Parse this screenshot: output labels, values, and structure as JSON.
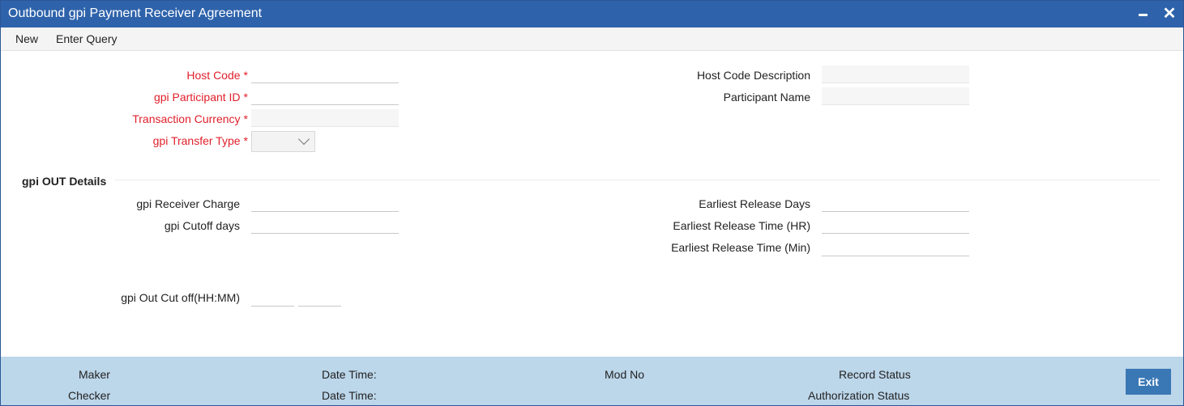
{
  "window": {
    "title": "Outbound gpi Payment Receiver Agreement",
    "close_glyph": "✕"
  },
  "menu": {
    "new": "New",
    "enter_query": "Enter Query"
  },
  "header_fields": {
    "host_code": {
      "label": "Host Code",
      "required_mark": "*",
      "value": ""
    },
    "gpi_participant_id": {
      "label": "gpi Participant ID",
      "required_mark": "*",
      "value": ""
    },
    "transaction_currency": {
      "label": "Transaction Currency",
      "required_mark": "*",
      "value": ""
    },
    "gpi_transfer_type": {
      "label": "gpi Transfer Type",
      "required_mark": "*",
      "value": ""
    },
    "host_code_description": {
      "label": "Host Code Description",
      "value": ""
    },
    "participant_name": {
      "label": "Participant Name",
      "value": ""
    }
  },
  "section": {
    "title": "gpi OUT Details"
  },
  "out_details": {
    "gpi_receiver_charge": {
      "label": "gpi Receiver Charge",
      "value": ""
    },
    "gpi_cutoff_days": {
      "label": "gpi Cutoff days",
      "value": ""
    },
    "earliest_release_days": {
      "label": "Earliest Release Days",
      "value": ""
    },
    "earliest_release_time_hr": {
      "label": "Earliest Release Time (HR)",
      "value": ""
    },
    "earliest_release_time_min": {
      "label": "Earliest Release Time (Min)",
      "value": ""
    },
    "gpi_out_cut_off": {
      "label": "gpi Out Cut off(HH:MM)",
      "hours": "",
      "minutes": ""
    }
  },
  "footer": {
    "maker": "Maker",
    "checker": "Checker",
    "date_time_1": "Date Time:",
    "date_time_2": "Date Time:",
    "mod_no": "Mod No",
    "record_status": "Record Status",
    "authorization_status": "Authorization Status",
    "exit": "Exit"
  },
  "colors": {
    "titlebar": "#2e63ab",
    "required_label": "#e0202b",
    "footer": "#bcd6ea",
    "exit_button": "#3a78b5"
  }
}
